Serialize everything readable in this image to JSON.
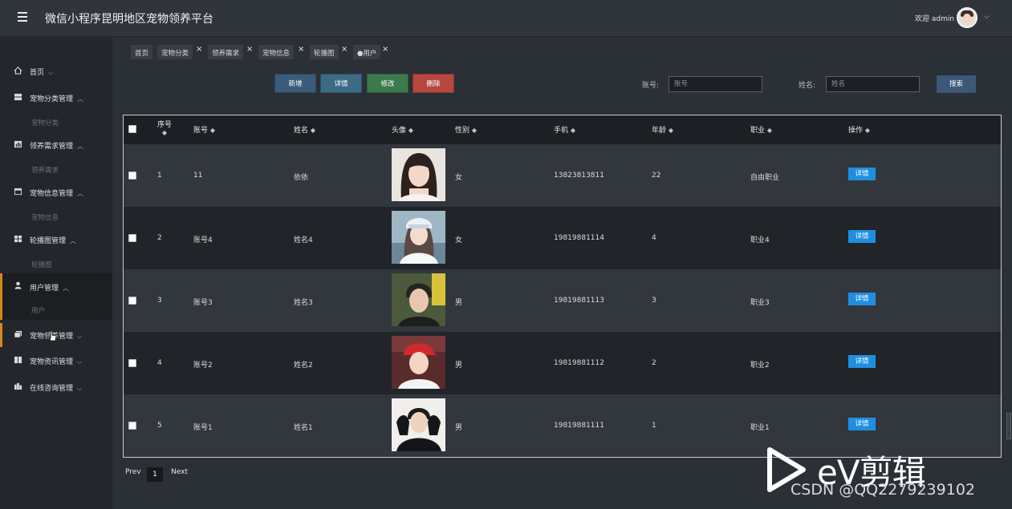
{
  "header": {
    "app_title": "微信小程序昆明地区宠物领养平台",
    "welcome_text": "欢迎 admin"
  },
  "sidebar": {
    "groups": [
      {
        "label": "首页",
        "icon": "home-icon",
        "sub": ""
      },
      {
        "label": "宠物分类管理",
        "icon": "server-icon",
        "sub": "宠物分类"
      },
      {
        "label": "领养需求管理",
        "icon": "chart-icon",
        "sub": "领养需求"
      },
      {
        "label": "宠物信息管理",
        "icon": "window-icon",
        "sub": "宠物信息"
      },
      {
        "label": "轮播图管理",
        "icon": "grid-icon",
        "sub": "轮播图"
      },
      {
        "label": "用户管理",
        "icon": "user-icon",
        "sub": "用户"
      },
      {
        "label": "宠物领养管理",
        "icon": "clone-icon",
        "sub": ""
      },
      {
        "label": "宠物资讯管理",
        "icon": "book-icon",
        "sub": ""
      },
      {
        "label": "在线咨询管理",
        "icon": "building-icon",
        "sub": ""
      }
    ]
  },
  "tabs": [
    "首页",
    "宠物分类",
    "领养需求",
    "宠物信息",
    "轮播图",
    "●用户"
  ],
  "toolbar": {
    "add": "新增",
    "detail": "详情",
    "edit": "修改",
    "delete": "删除"
  },
  "filters": {
    "account_label": "账号:",
    "account_placeholder": "账号",
    "name_label": "姓名:",
    "name_placeholder": "姓名",
    "search": "搜索"
  },
  "table": {
    "headers": [
      "序号",
      "账号",
      "姓名",
      "头像",
      "性别",
      "手机",
      "年龄",
      "职业",
      "操作"
    ],
    "rows": [
      {
        "no": "1",
        "account": "11",
        "name": "依依",
        "gender": "女",
        "phone": "13823813811",
        "age": "22",
        "job": "自由职业",
        "action": "详情"
      },
      {
        "no": "2",
        "account": "账号4",
        "name": "姓名4",
        "gender": "女",
        "phone": "19819881114",
        "age": "4",
        "job": "职业4",
        "action": "详情"
      },
      {
        "no": "3",
        "account": "账号3",
        "name": "姓名3",
        "gender": "男",
        "phone": "19819881113",
        "age": "3",
        "job": "职业3",
        "action": "详情"
      },
      {
        "no": "4",
        "account": "账号2",
        "name": "姓名2",
        "gender": "男",
        "phone": "19819881112",
        "age": "2",
        "job": "职业2",
        "action": "详情"
      },
      {
        "no": "5",
        "account": "账号1",
        "name": "姓名1",
        "gender": "男",
        "phone": "19819881111",
        "age": "1",
        "job": "职业1",
        "action": "详情"
      }
    ]
  },
  "pager": {
    "prev": "Prev",
    "current": "1",
    "next": "Next"
  },
  "watermark": {
    "text": "eV剪辑",
    "csdn": "CSDN @QQ2279239102"
  },
  "colors": {
    "add": "#3a5c7a",
    "detail": "#3b6b85",
    "edit": "#3c7a4b",
    "delete": "#b5473f",
    "accent": "#d5871c",
    "link_blue": "#1e8fe0"
  }
}
